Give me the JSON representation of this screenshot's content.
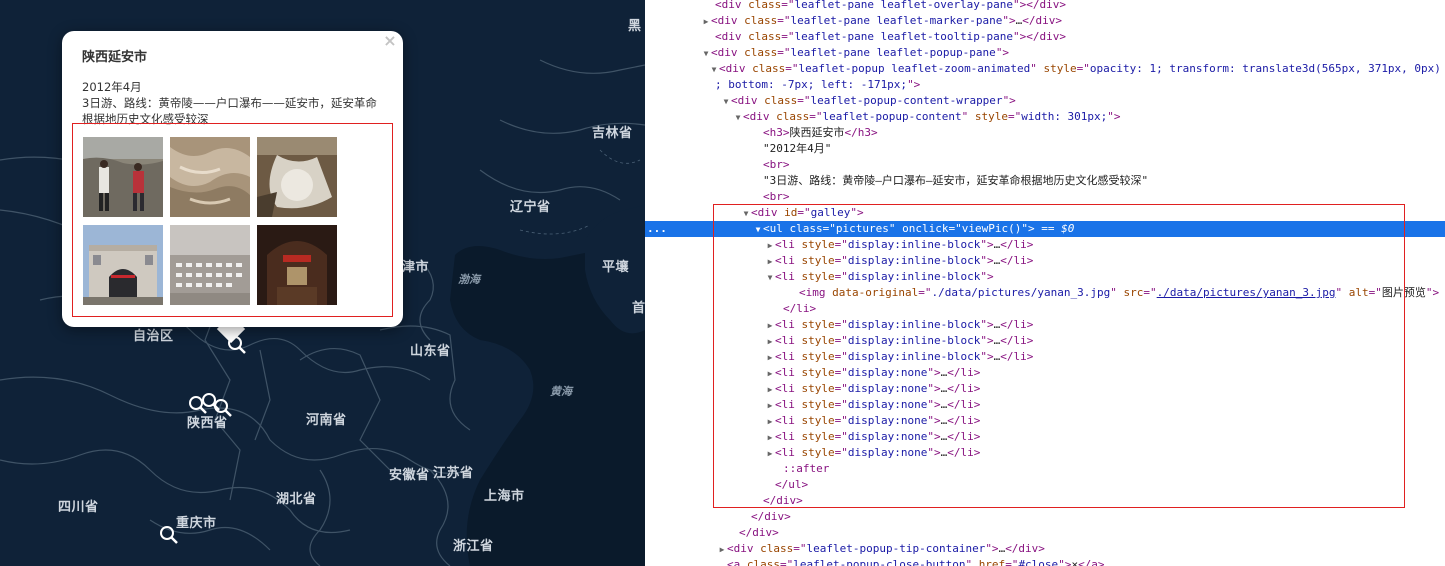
{
  "map": {
    "provinces": [
      {
        "text": "吉林省"
      },
      {
        "text": "辽宁省"
      },
      {
        "text": "津市"
      },
      {
        "text": "平壤"
      },
      {
        "text": "首"
      },
      {
        "text": "山东省"
      },
      {
        "text": "河南省"
      },
      {
        "text": "陕西省"
      },
      {
        "text": "自治区"
      },
      {
        "text": "安徽省"
      },
      {
        "text": "江苏省"
      },
      {
        "text": "上海市"
      },
      {
        "text": "湖北省"
      },
      {
        "text": "四川省"
      },
      {
        "text": "重庆市"
      },
      {
        "text": "浙江省"
      },
      {
        "text": "黑"
      }
    ],
    "seas": [
      {
        "text": "渤海"
      },
      {
        "text": "黄海"
      }
    ]
  },
  "popup": {
    "title": "陕西延安市",
    "date": "2012年4月",
    "description": "3日游、路线：黄帝陵——户口瀑布——延安市，延安革命根据地历史文化感受较深",
    "close": "×"
  },
  "devtools": {
    "lines": [
      {
        "t": "",
        "parts": [
          [
            "tag",
            "<div "
          ],
          [
            "attr",
            "class"
          ],
          [
            "tag",
            "=\""
          ],
          [
            "val",
            "leaflet-pane leaflet-overlay-pane"
          ],
          [
            "tag",
            "\"></div>"
          ]
        ]
      },
      {
        "t": "▶",
        "parts": [
          [
            "tag",
            "<div "
          ],
          [
            "attr",
            "class"
          ],
          [
            "tag",
            "=\""
          ],
          [
            "val",
            "leaflet-pane leaflet-marker-pane"
          ],
          [
            "tag",
            "\">"
          ],
          [
            "txt",
            "…"
          ],
          [
            "tag",
            "</div>"
          ]
        ]
      },
      {
        "t": "",
        "parts": [
          [
            "tag",
            "<div "
          ],
          [
            "attr",
            "class"
          ],
          [
            "tag",
            "=\""
          ],
          [
            "val",
            "leaflet-pane leaflet-tooltip-pane"
          ],
          [
            "tag",
            "\"></div>"
          ]
        ]
      },
      {
        "t": "▼",
        "parts": [
          [
            "tag",
            "<div "
          ],
          [
            "attr",
            "class"
          ],
          [
            "tag",
            "=\""
          ],
          [
            "val",
            "leaflet-pane leaflet-popup-pane"
          ],
          [
            "tag",
            "\">"
          ]
        ]
      },
      {
        "t": "▼",
        "parts": [
          [
            "tag",
            "<div "
          ],
          [
            "attr",
            "class"
          ],
          [
            "tag",
            "=\""
          ],
          [
            "val",
            "leaflet-popup  leaflet-zoom-animated"
          ],
          [
            "tag",
            "\" "
          ],
          [
            "attr",
            "style"
          ],
          [
            "tag",
            "=\""
          ],
          [
            "val",
            "opacity: 1; transform: translate3d(565px, 371px, 0px)"
          ]
        ]
      },
      {
        "t": "",
        "parts": [
          [
            "val",
            "; bottom: -7px; left: -171px;"
          ],
          [
            "tag",
            "\">"
          ]
        ]
      },
      {
        "t": "▼",
        "parts": [
          [
            "tag",
            "<div "
          ],
          [
            "attr",
            "class"
          ],
          [
            "tag",
            "=\""
          ],
          [
            "val",
            "leaflet-popup-content-wrapper"
          ],
          [
            "tag",
            "\">"
          ]
        ]
      },
      {
        "t": "▼",
        "parts": [
          [
            "tag",
            "<div "
          ],
          [
            "attr",
            "class"
          ],
          [
            "tag",
            "=\""
          ],
          [
            "val",
            "leaflet-popup-content"
          ],
          [
            "tag",
            "\" "
          ],
          [
            "attr",
            "style"
          ],
          [
            "tag",
            "=\""
          ],
          [
            "val",
            "width: 301px;"
          ],
          [
            "tag",
            "\">"
          ]
        ]
      },
      {
        "t": "",
        "parts": [
          [
            "tag",
            "<h3>"
          ],
          [
            "txt",
            "陕西延安市"
          ],
          [
            "tag",
            "</h3>"
          ]
        ]
      },
      {
        "t": "",
        "parts": [
          [
            "txt",
            "\"2012年4月\""
          ]
        ]
      },
      {
        "t": "",
        "parts": [
          [
            "tag",
            "<br>"
          ]
        ]
      },
      {
        "t": "",
        "parts": [
          [
            "txt",
            "\"3日游、路线：黄帝陵—户口瀑布—延安市，延安革命根据地历史文化感受较深\""
          ]
        ]
      },
      {
        "t": "",
        "parts": [
          [
            "tag",
            "<br>"
          ]
        ]
      },
      {
        "t": "▼",
        "parts": [
          [
            "tag",
            "<div "
          ],
          [
            "attr",
            "id"
          ],
          [
            "tag",
            "=\""
          ],
          [
            "val",
            "galley"
          ],
          [
            "tag",
            "\">"
          ]
        ]
      },
      {
        "t": "▼",
        "parts": [
          [
            "tag",
            "<ul "
          ],
          [
            "attr",
            "class"
          ],
          [
            "tag",
            "=\""
          ],
          [
            "val",
            "pictures"
          ],
          [
            "tag",
            "\" "
          ],
          [
            "attr",
            "onclick"
          ],
          [
            "tag",
            "=\""
          ],
          [
            "val",
            "viewPic()"
          ],
          [
            "tag",
            "\">"
          ],
          [
            "cmt",
            " == $0"
          ]
        ]
      },
      {
        "t": "▶",
        "parts": [
          [
            "tag",
            "<li "
          ],
          [
            "attr",
            "style"
          ],
          [
            "tag",
            "=\""
          ],
          [
            "val",
            "display:inline-block"
          ],
          [
            "tag",
            "\">"
          ],
          [
            "txt",
            "…"
          ],
          [
            "tag",
            "</li>"
          ]
        ]
      },
      {
        "t": "▶",
        "parts": [
          [
            "tag",
            "<li "
          ],
          [
            "attr",
            "style"
          ],
          [
            "tag",
            "=\""
          ],
          [
            "val",
            "display:inline-block"
          ],
          [
            "tag",
            "\">"
          ],
          [
            "txt",
            "…"
          ],
          [
            "tag",
            "</li>"
          ]
        ]
      },
      {
        "t": "▼",
        "parts": [
          [
            "tag",
            "<li "
          ],
          [
            "attr",
            "style"
          ],
          [
            "tag",
            "=\""
          ],
          [
            "val",
            "display:inline-block"
          ],
          [
            "tag",
            "\">"
          ]
        ]
      },
      {
        "t": "",
        "parts": [
          [
            "tag",
            "<img "
          ],
          [
            "attr",
            "data-original"
          ],
          [
            "tag",
            "=\""
          ],
          [
            "val",
            "./data/pictures/yanan_3.jpg"
          ],
          [
            "tag",
            "\" "
          ],
          [
            "attr",
            "src"
          ],
          [
            "tag",
            "=\""
          ],
          [
            "url",
            "./data/pictures/yanan_3.jpg"
          ],
          [
            "tag",
            "\" "
          ],
          [
            "attr",
            "alt"
          ],
          [
            "tag",
            "=\""
          ],
          [
            "txt",
            "图片预览"
          ],
          [
            "tag",
            "\">"
          ]
        ]
      },
      {
        "t": "",
        "parts": [
          [
            "tag",
            "</li>"
          ]
        ]
      },
      {
        "t": "▶",
        "parts": [
          [
            "tag",
            "<li "
          ],
          [
            "attr",
            "style"
          ],
          [
            "tag",
            "=\""
          ],
          [
            "val",
            "display:inline-block"
          ],
          [
            "tag",
            "\">"
          ],
          [
            "txt",
            "…"
          ],
          [
            "tag",
            "</li>"
          ]
        ]
      },
      {
        "t": "▶",
        "parts": [
          [
            "tag",
            "<li "
          ],
          [
            "attr",
            "style"
          ],
          [
            "tag",
            "=\""
          ],
          [
            "val",
            "display:inline-block"
          ],
          [
            "tag",
            "\">"
          ],
          [
            "txt",
            "…"
          ],
          [
            "tag",
            "</li>"
          ]
        ]
      },
      {
        "t": "▶",
        "parts": [
          [
            "tag",
            "<li "
          ],
          [
            "attr",
            "style"
          ],
          [
            "tag",
            "=\""
          ],
          [
            "val",
            "display:inline-block"
          ],
          [
            "tag",
            "\">"
          ],
          [
            "txt",
            "…"
          ],
          [
            "tag",
            "</li>"
          ]
        ]
      },
      {
        "t": "▶",
        "parts": [
          [
            "tag",
            "<li "
          ],
          [
            "attr",
            "style"
          ],
          [
            "tag",
            "=\""
          ],
          [
            "val",
            "display:none"
          ],
          [
            "tag",
            "\">"
          ],
          [
            "txt",
            "…"
          ],
          [
            "tag",
            "</li>"
          ]
        ]
      },
      {
        "t": "▶",
        "parts": [
          [
            "tag",
            "<li "
          ],
          [
            "attr",
            "style"
          ],
          [
            "tag",
            "=\""
          ],
          [
            "val",
            "display:none"
          ],
          [
            "tag",
            "\">"
          ],
          [
            "txt",
            "…"
          ],
          [
            "tag",
            "</li>"
          ]
        ]
      },
      {
        "t": "▶",
        "parts": [
          [
            "tag",
            "<li "
          ],
          [
            "attr",
            "style"
          ],
          [
            "tag",
            "=\""
          ],
          [
            "val",
            "display:none"
          ],
          [
            "tag",
            "\">"
          ],
          [
            "txt",
            "…"
          ],
          [
            "tag",
            "</li>"
          ]
        ]
      },
      {
        "t": "▶",
        "parts": [
          [
            "tag",
            "<li "
          ],
          [
            "attr",
            "style"
          ],
          [
            "tag",
            "=\""
          ],
          [
            "val",
            "display:none"
          ],
          [
            "tag",
            "\">"
          ],
          [
            "txt",
            "…"
          ],
          [
            "tag",
            "</li>"
          ]
        ]
      },
      {
        "t": "▶",
        "parts": [
          [
            "tag",
            "<li "
          ],
          [
            "attr",
            "style"
          ],
          [
            "tag",
            "=\""
          ],
          [
            "val",
            "display:none"
          ],
          [
            "tag",
            "\">"
          ],
          [
            "txt",
            "…"
          ],
          [
            "tag",
            "</li>"
          ]
        ]
      },
      {
        "t": "▶",
        "parts": [
          [
            "tag",
            "<li "
          ],
          [
            "attr",
            "style"
          ],
          [
            "tag",
            "=\""
          ],
          [
            "val",
            "display:none"
          ],
          [
            "tag",
            "\">"
          ],
          [
            "txt",
            "…"
          ],
          [
            "tag",
            "</li>"
          ]
        ]
      },
      {
        "t": "",
        "parts": [
          [
            "pseudo",
            "::after"
          ]
        ]
      },
      {
        "t": "",
        "parts": [
          [
            "tag",
            "</ul>"
          ]
        ]
      },
      {
        "t": "",
        "parts": [
          [
            "tag",
            "</div>"
          ]
        ]
      },
      {
        "t": "",
        "parts": [
          [
            "tag",
            "</div>"
          ]
        ]
      },
      {
        "t": "",
        "parts": [
          [
            "tag",
            "</div>"
          ]
        ]
      },
      {
        "t": "▶",
        "parts": [
          [
            "tag",
            "<div "
          ],
          [
            "attr",
            "class"
          ],
          [
            "tag",
            "=\""
          ],
          [
            "val",
            "leaflet-popup-tip-container"
          ],
          [
            "tag",
            "\">"
          ],
          [
            "txt",
            "…"
          ],
          [
            "tag",
            "</div>"
          ]
        ]
      },
      {
        "t": "",
        "parts": [
          [
            "tag",
            "<a "
          ],
          [
            "attr",
            "class"
          ],
          [
            "tag",
            "=\""
          ],
          [
            "val",
            "leaflet-popup-close-button"
          ],
          [
            "tag",
            "\" "
          ],
          [
            "attr",
            "href"
          ],
          [
            "tag",
            "=\""
          ],
          [
            "val",
            "#close"
          ],
          [
            "tag",
            "\">"
          ],
          [
            "txt",
            "×"
          ],
          [
            "tag",
            "</a>"
          ]
        ]
      }
    ],
    "row_dots": "..."
  }
}
